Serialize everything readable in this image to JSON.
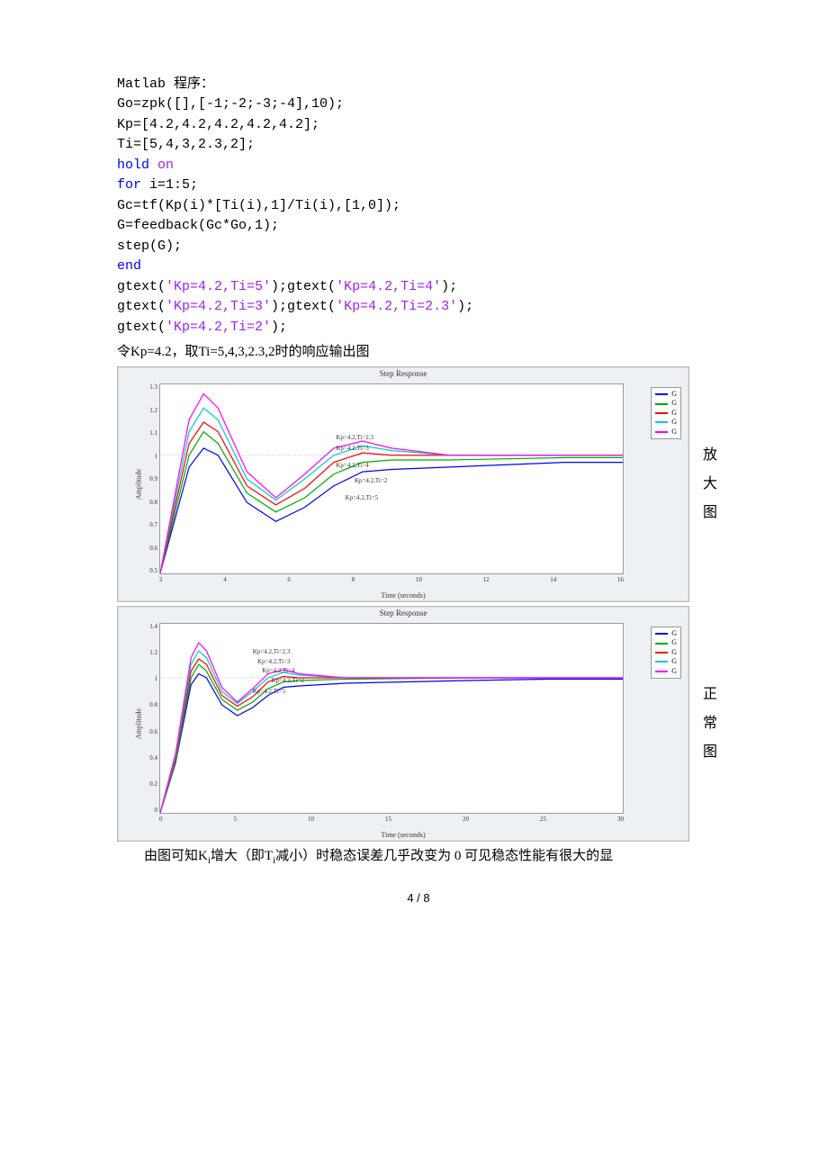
{
  "code": {
    "l1": "Matlab 程序：",
    "l2": "Go=zpk([],[-1;-2;-3;-4],10);",
    "l3": "Kp=[4.2,4.2,4.2,4.2,4.2];",
    "l4": "Ti=[5,4,3,2.3,2];",
    "l5a": "hold ",
    "l5b": "on",
    "l6a": "for ",
    "l6b": "i=1:5;",
    "l7": "Gc=tf(Kp(i)*[Ti(i),1]/Ti(i),[1,0]);",
    "l8": "G=feedback(Gc*Go,1);",
    "l9": "step(G);",
    "l10": "end",
    "l11a": "gtext(",
    "l11b": "'Kp=4.2,Ti=5'",
    "l11c": ");gtext(",
    "l11d": "'Kp=4.2,Ti=4'",
    "l11e": ");",
    "l12a": "gtext(",
    "l12b": "'Kp=4.2,Ti=3'",
    "l12c": ");gtext(",
    "l12d": "'Kp=4.2,Ti=2.3'",
    "l12e": ");",
    "l13a": "gtext(",
    "l13b": "'Kp=4.2,Ti=2'",
    "l13c": ");"
  },
  "caption1": "令Kp=4.2，取Ti=5,4,3,2.3,2时的响应输出图",
  "side1": [
    "放",
    "大",
    "图"
  ],
  "side2": [
    "正",
    "常",
    "图"
  ],
  "conclusion_pre": "由图可知K",
  "conclusion_sub1": "i",
  "conclusion_mid1": "增大（即T",
  "conclusion_sub2": "i",
  "conclusion_mid2": "减小）时稳态误差几乎改变为 0 可见稳态性能有很大的显",
  "footer": "4 / 8",
  "chart_data": [
    {
      "type": "line",
      "title": "Step Response",
      "xlabel": "Time (seconds)",
      "ylabel": "Amplitude",
      "xlim": [
        1,
        17
      ],
      "ylim": [
        0.5,
        1.3
      ],
      "yticks": [
        1.3,
        1.2,
        1.1,
        1,
        0.9,
        0.8,
        0.7,
        0.6,
        0.5
      ],
      "xticks": [
        2,
        4,
        6,
        8,
        10,
        12,
        14,
        16
      ],
      "legend": [
        "G",
        "G",
        "G",
        "G",
        "G"
      ],
      "colors": [
        "#0000ff",
        "#00aa00",
        "#ff0000",
        "#00cccc",
        "#ff00ff"
      ],
      "annotations": [
        "Kp=4.2,Ti=2.3",
        "Kp=4.2,Ti=3",
        "Kp=4.2,Ti=4",
        "Kp=4.2,Ti=2",
        "Kp=4.2,Ti=5"
      ],
      "reference_y": 1.0,
      "series": [
        {
          "name": "Ti=5",
          "color": "#0000ff",
          "x": [
            1,
            2,
            2.5,
            3,
            4,
            5,
            6,
            7,
            8,
            9,
            11,
            13,
            15,
            17
          ],
          "y": [
            0.5,
            0.95,
            1.03,
            1.0,
            0.8,
            0.72,
            0.78,
            0.87,
            0.93,
            0.94,
            0.95,
            0.96,
            0.97,
            0.97
          ]
        },
        {
          "name": "Ti=4",
          "color": "#00aa00",
          "x": [
            1,
            2,
            2.5,
            3,
            4,
            5,
            6,
            7,
            8,
            9,
            11,
            13,
            15,
            17
          ],
          "y": [
            0.5,
            1.0,
            1.1,
            1.05,
            0.84,
            0.76,
            0.82,
            0.92,
            0.97,
            0.98,
            0.98,
            0.985,
            0.99,
            0.99
          ]
        },
        {
          "name": "Ti=3",
          "color": "#ff0000",
          "x": [
            1,
            2,
            2.5,
            3,
            4,
            5,
            6,
            7,
            8,
            9,
            11,
            13,
            15,
            17
          ],
          "y": [
            0.5,
            1.05,
            1.14,
            1.1,
            0.87,
            0.79,
            0.86,
            0.97,
            1.01,
            1.0,
            1.0,
            1.0,
            1.0,
            1.0
          ]
        },
        {
          "name": "Ti=2.3",
          "color": "#00cccc",
          "x": [
            1,
            2,
            2.5,
            3,
            4,
            5,
            6,
            7,
            8,
            9,
            11,
            13,
            15,
            17
          ],
          "y": [
            0.5,
            1.1,
            1.2,
            1.15,
            0.9,
            0.81,
            0.9,
            1.0,
            1.04,
            1.02,
            1.0,
            1.0,
            1.0,
            1.0
          ]
        },
        {
          "name": "Ti=2",
          "color": "#ff00ff",
          "x": [
            1,
            2,
            2.5,
            3,
            4,
            5,
            6,
            7,
            8,
            9,
            11,
            13,
            15,
            17
          ],
          "y": [
            0.5,
            1.15,
            1.26,
            1.2,
            0.93,
            0.82,
            0.92,
            1.03,
            1.06,
            1.03,
            1.0,
            1.0,
            1.0,
            1.0
          ]
        }
      ]
    },
    {
      "type": "line",
      "title": "Step Response",
      "xlabel": "Time (seconds)",
      "ylabel": "Amplitude",
      "xlim": [
        0,
        30
      ],
      "ylim": [
        0,
        1.4
      ],
      "yticks": [
        1.4,
        1.2,
        1,
        0.8,
        0.6,
        0.4,
        0.2,
        0
      ],
      "xticks": [
        0,
        5,
        10,
        15,
        20,
        25,
        30
      ],
      "legend": [
        "G",
        "G",
        "G",
        "G",
        "G"
      ],
      "colors": [
        "#0000ff",
        "#00aa00",
        "#ff0000",
        "#00cccc",
        "#ff00ff"
      ],
      "annotations": [
        "Kp=4.2,Ti=2.3",
        "Kp=4.2,Ti=3",
        "Kp=4.2,Ti=4",
        "Kp=4.2,Ti=2",
        "Kp=4.2,Ti=5"
      ],
      "reference_y": 1.0,
      "series": [
        {
          "name": "Ti=5",
          "color": "#0000ff",
          "x": [
            0,
            1,
            2,
            2.5,
            3,
            4,
            5,
            6,
            7,
            8,
            9,
            12,
            16,
            20,
            25,
            30
          ],
          "y": [
            0,
            0.37,
            0.95,
            1.03,
            1.0,
            0.8,
            0.72,
            0.78,
            0.87,
            0.93,
            0.94,
            0.96,
            0.97,
            0.98,
            0.99,
            0.99
          ]
        },
        {
          "name": "Ti=4",
          "color": "#00aa00",
          "x": [
            0,
            1,
            2,
            2.5,
            3,
            4,
            5,
            6,
            7,
            8,
            9,
            12,
            16,
            20,
            25,
            30
          ],
          "y": [
            0,
            0.38,
            1.0,
            1.1,
            1.05,
            0.84,
            0.76,
            0.82,
            0.92,
            0.97,
            0.98,
            0.99,
            0.995,
            1.0,
            1.0,
            1.0
          ]
        },
        {
          "name": "Ti=3",
          "color": "#ff0000",
          "x": [
            0,
            1,
            2,
            2.5,
            3,
            4,
            5,
            6,
            7,
            8,
            9,
            12,
            16,
            20,
            25,
            30
          ],
          "y": [
            0,
            0.4,
            1.05,
            1.14,
            1.1,
            0.87,
            0.79,
            0.86,
            0.97,
            1.01,
            1.0,
            1.0,
            1.0,
            1.0,
            1.0,
            1.0
          ]
        },
        {
          "name": "Ti=2.3",
          "color": "#00cccc",
          "x": [
            0,
            1,
            2,
            2.5,
            3,
            4,
            5,
            6,
            7,
            8,
            9,
            12,
            16,
            20,
            25,
            30
          ],
          "y": [
            0,
            0.42,
            1.1,
            1.2,
            1.15,
            0.9,
            0.81,
            0.9,
            1.0,
            1.04,
            1.02,
            1.0,
            1.0,
            1.0,
            1.0,
            1.0
          ]
        },
        {
          "name": "Ti=2",
          "color": "#ff00ff",
          "x": [
            0,
            1,
            2,
            2.5,
            3,
            4,
            5,
            6,
            7,
            8,
            9,
            12,
            16,
            20,
            25,
            30
          ],
          "y": [
            0,
            0.44,
            1.15,
            1.26,
            1.2,
            0.93,
            0.82,
            0.92,
            1.03,
            1.06,
            1.03,
            1.0,
            1.0,
            1.0,
            1.0,
            1.0
          ]
        }
      ]
    }
  ]
}
